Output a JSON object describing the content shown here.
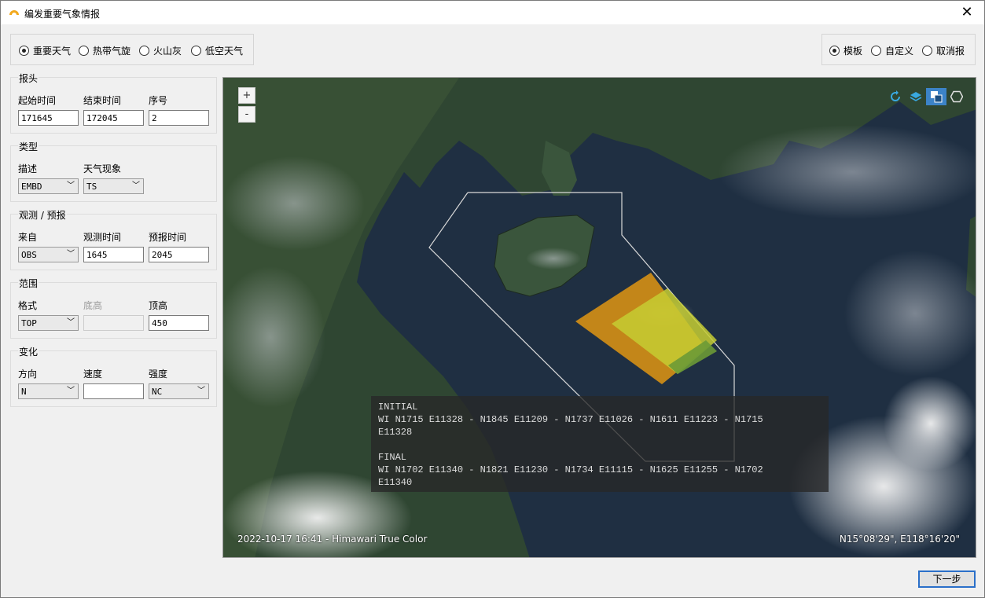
{
  "window": {
    "title": "编发重要气象情报",
    "close_glyph": "✕"
  },
  "type_options": [
    {
      "label": "重要天气",
      "selected": true
    },
    {
      "label": "热带气旋",
      "selected": false
    },
    {
      "label": "火山灰",
      "selected": false
    },
    {
      "label": "低空天气",
      "selected": false
    }
  ],
  "mode_options": [
    {
      "label": "模板",
      "selected": true
    },
    {
      "label": "自定义",
      "selected": false
    },
    {
      "label": "取消报",
      "selected": false
    }
  ],
  "header_group": {
    "title": "报头",
    "start_label": "起始时间",
    "start_value": "171645",
    "end_label": "结束时间",
    "end_value": "172045",
    "seq_label": "序号",
    "seq_value": "2"
  },
  "type_group": {
    "title": "类型",
    "desc_label": "描述",
    "desc_value": "EMBD",
    "phen_label": "天气现象",
    "phen_value": "TS"
  },
  "obs_group": {
    "title": "观测 / 预报",
    "from_label": "来自",
    "from_value": "OBS",
    "obs_label": "观测时间",
    "obs_value": "1645",
    "fc_label": "预报时间",
    "fc_value": "2045"
  },
  "range_group": {
    "title": "范围",
    "fmt_label": "格式",
    "fmt_value": "TOP",
    "base_label": "底高",
    "base_value": "",
    "top_label": "顶高",
    "top_value": "450"
  },
  "change_group": {
    "title": "变化",
    "dir_label": "方向",
    "dir_value": "N",
    "speed_label": "速度",
    "speed_value": "",
    "int_label": "强度",
    "int_value": "NC"
  },
  "map": {
    "zoom_in": "+",
    "zoom_out": "-",
    "tools": [
      "refresh-icon",
      "layers-icon",
      "fill-toggle-icon",
      "hexagon-icon"
    ],
    "sigmet": {
      "initial_title": "INITIAL",
      "initial_line1": "WI N1715 E11328 - N1845 E11209 - N1737 E11026 - N1611 E11223 - N1715",
      "initial_line2": "E11328",
      "final_title": "FINAL",
      "final_line1": "WI N1702 E11340 - N1821 E11230 - N1734 E11115 - N1625 E11255 - N1702",
      "final_line2": "E11340"
    },
    "timestamp": "2022-10-17 16:41 - Himawari True Color",
    "coordinates": "N15°08'29\", E118°16'20\""
  },
  "next_button": "下一步",
  "colors": {
    "initial_area": "#e89a10",
    "final_area": "#c6cc33",
    "overlap_tail": "#6b9a36",
    "accent": "#2a6fc9"
  }
}
